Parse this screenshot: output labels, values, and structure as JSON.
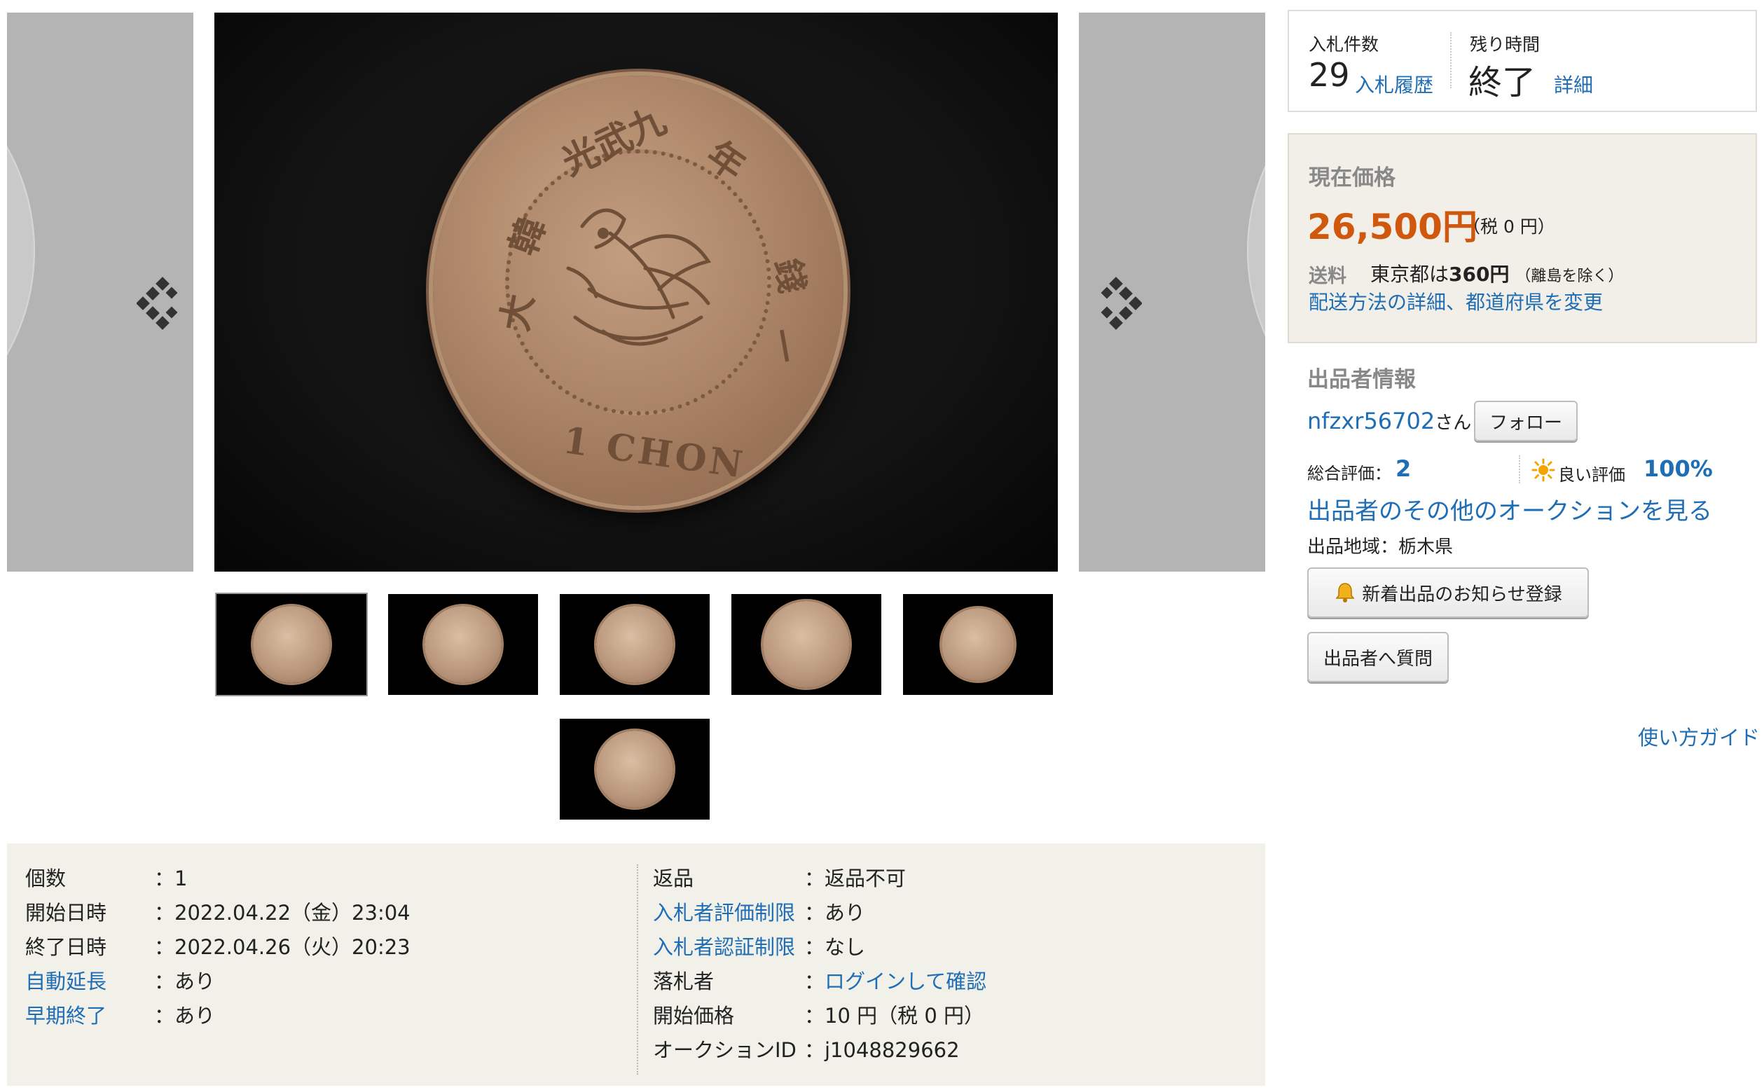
{
  "gallery": {
    "coin_legend": "1 CHON",
    "thumbnails": [
      {
        "name": "thumb-1"
      },
      {
        "name": "thumb-2"
      },
      {
        "name": "thumb-3"
      },
      {
        "name": "thumb-4"
      },
      {
        "name": "thumb-5"
      },
      {
        "name": "thumb-6"
      }
    ]
  },
  "bids": {
    "count_label": "入札件数",
    "count": "29",
    "history_link": "入札履歴",
    "time_label": "残り時間",
    "time_value": "終了",
    "detail_link": "詳細"
  },
  "price": {
    "label": "現在価格",
    "value": "26,500円",
    "tax": "（税 0 円）",
    "shipping_label": "送料",
    "shipping_prefix": "東京都は",
    "shipping_amount": "360円",
    "shipping_note": "（離島を除く）",
    "shipping_link": "配送方法の詳細、都道府県を変更",
    "accent_color": "#d0570e"
  },
  "seller": {
    "heading": "出品者情報",
    "name": "nfzxr56702",
    "suffix": "さん",
    "follow_button": "フォロー",
    "rating_label": "総合評価：",
    "rating_value": "2",
    "good_label": "良い評価",
    "good_value": "100%",
    "other_auctions_link": "出品者のその他のオークションを見る",
    "region": "出品地域：栃木県",
    "notify_button": "新着出品のお知らせ登録",
    "question_button": "出品者へ質問",
    "icons": {
      "sun": "sun-icon",
      "bell": "bell-icon"
    }
  },
  "guide_link": "使い方ガイド",
  "details": {
    "left": [
      {
        "key": "個数",
        "value": "：1",
        "key_link": false
      },
      {
        "key": "開始日時",
        "value": "：2022.04.22（金）23:04",
        "key_link": false
      },
      {
        "key": "終了日時",
        "value": "：2022.04.26（火）20:23",
        "key_link": false
      },
      {
        "key": "自動延長",
        "value": "：あり",
        "key_link": true
      },
      {
        "key": "早期終了",
        "value": "：あり",
        "key_link": true
      }
    ],
    "right": [
      {
        "key": "返品",
        "value": "：返品不可",
        "key_link": false
      },
      {
        "key": "入札者評価制限",
        "value": "：あり",
        "key_link": true
      },
      {
        "key": "入札者認証制限",
        "value": "：なし",
        "key_link": true
      },
      {
        "key": "落札者",
        "colon": "：",
        "value_link": "ログインして確認",
        "key_link": false
      },
      {
        "key": "開始価格",
        "value": "：10 円（税 0 円）",
        "key_link": false
      },
      {
        "key": "オークションID",
        "value": "：j1048829662",
        "key_link": false
      }
    ]
  }
}
